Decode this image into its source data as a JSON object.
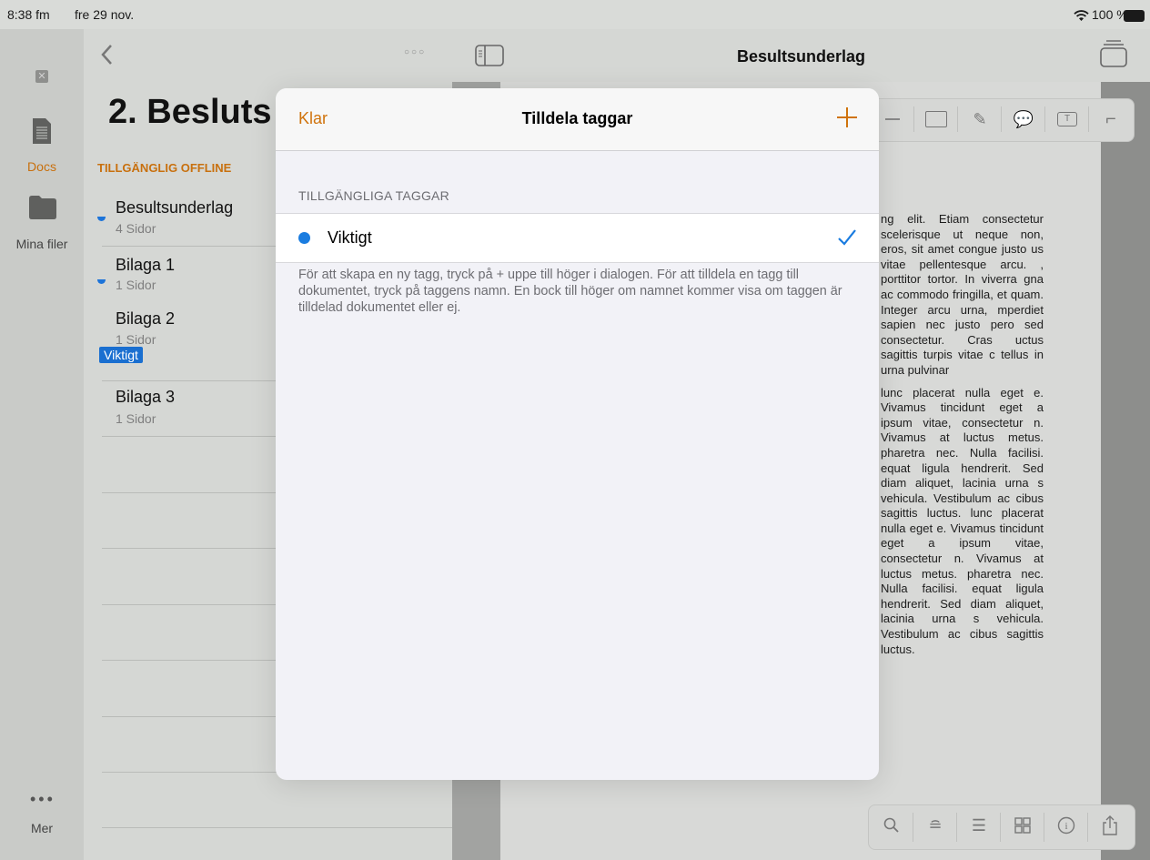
{
  "status_bar": {
    "time": "8:38 fm",
    "date": "fre 29 nov.",
    "battery": "100 %"
  },
  "rail": {
    "items": [
      {
        "label": "Docs",
        "icon": "document-icon",
        "active": true
      },
      {
        "label": "Mina filer",
        "icon": "folder-icon",
        "active": false
      }
    ],
    "more_label": "Mer"
  },
  "list_pane": {
    "title": "2. Besluts",
    "section_header": "TILLGÄNGLIG OFFLINE",
    "items": [
      {
        "title": "Besultsunderlag",
        "subtitle": "4 Sidor"
      },
      {
        "title": "Bilaga 1",
        "subtitle": "1 Sidor"
      },
      {
        "title": "Bilaga 2",
        "subtitle": "1 Sidor",
        "tag": "Viktigt"
      },
      {
        "title": "Bilaga 3",
        "subtitle": "1 Sidor"
      }
    ]
  },
  "document": {
    "title": "Besultsunderlag",
    "paragraphs": [
      "ng elit. Etiam consectetur scelerisque ut neque non, eros, sit amet congue justo us vitae pellentesque arcu. , porttitor tortor. In viverra gna ac commodo fringilla, et quam. Integer arcu urna, mperdiet sapien nec justo pero sed consectetur. Cras uctus sagittis turpis vitae c tellus in urna pulvinar",
      "lunc placerat nulla eget e. Vivamus tincidunt eget a ipsum vitae, consectetur n. Vivamus at luctus metus. pharetra nec. Nulla facilisi. equat ligula hendrerit. Sed diam aliquet, lacinia urna s vehicula. Vestibulum ac cibus sagittis luctus. lunc placerat nulla eget e. Vivamus tincidunt eget a ipsum vitae, consectetur n. Vivamus at luctus metus. pharetra nec. Nulla facilisi. equat ligula hendrerit. Sed diam aliquet, lacinia urna s vehicula. Vestibulum ac cibus sagittis luctus."
    ]
  },
  "modal": {
    "done_label": "Klar",
    "title": "Tilldela taggar",
    "section_header": "TILLGÄNGLIGA TAGGAR",
    "tags": [
      {
        "name": "Viktigt",
        "color": "#1a7ce0",
        "assigned": true
      }
    ],
    "footer": "För att skapa en ny tagg, tryck på + uppe till höger i dialogen. För att tilldela en tagg till dokumentet, tryck på taggens namn. En bock till höger om namnet kommer visa om taggen är tilldelad dokumentet eller ej."
  },
  "colors": {
    "accent": "#d0730c",
    "tag_blue": "#1a7ce0",
    "check_blue": "#1a7ce0"
  }
}
